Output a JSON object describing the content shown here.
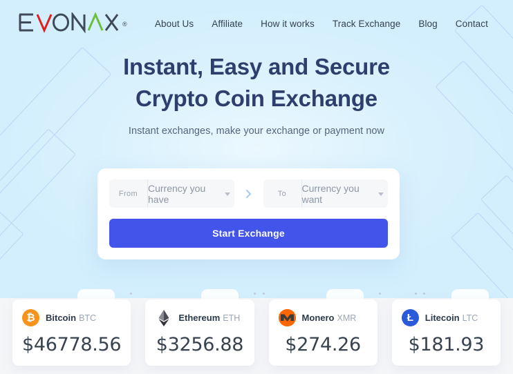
{
  "brand": {
    "logo_text": "EVONAX",
    "logo_registered": "®",
    "logo_colors": {
      "base": "#3e4a59",
      "v_accent": "#e02020",
      "a_accent": "#6cbf3a"
    }
  },
  "nav": {
    "items": [
      {
        "label": "About Us"
      },
      {
        "label": "Affiliate"
      },
      {
        "label": "How it works"
      },
      {
        "label": "Track Exchange"
      },
      {
        "label": "Blog"
      },
      {
        "label": "Contact"
      }
    ]
  },
  "hero": {
    "headline_line1": "Instant, Easy and Secure",
    "headline_line2": "Crypto Coin Exchange",
    "subtitle": "Instant exchanges, make your exchange or payment now",
    "background_color": "#d3effd",
    "headline_color": "#2f3f6d"
  },
  "exchange": {
    "from_label": "From",
    "from_value": "Currency you have",
    "swap_icon": "chevron-right-icon",
    "to_label": "To",
    "to_value": "Currency you want",
    "submit_label": "Start Exchange",
    "submit_color": "#4254ea"
  },
  "coins": [
    {
      "icon": "bitcoin-icon",
      "glyph": "₿",
      "name": "Bitcoin",
      "symbol": "BTC",
      "price": "$46778.56",
      "color": "#f7931a"
    },
    {
      "icon": "ethereum-icon",
      "glyph": "♦",
      "name": "Ethereum",
      "symbol": "ETH",
      "price": "$3256.88",
      "color": "#3c3c3d"
    },
    {
      "icon": "monero-icon",
      "glyph": "M",
      "name": "Monero",
      "symbol": "XMR",
      "price": "$274.26",
      "color": "#ff6600"
    },
    {
      "icon": "litecoin-icon",
      "glyph": "Ł",
      "name": "Litecoin",
      "symbol": "LTC",
      "price": "$181.93",
      "color": "#2a5ada"
    }
  ]
}
